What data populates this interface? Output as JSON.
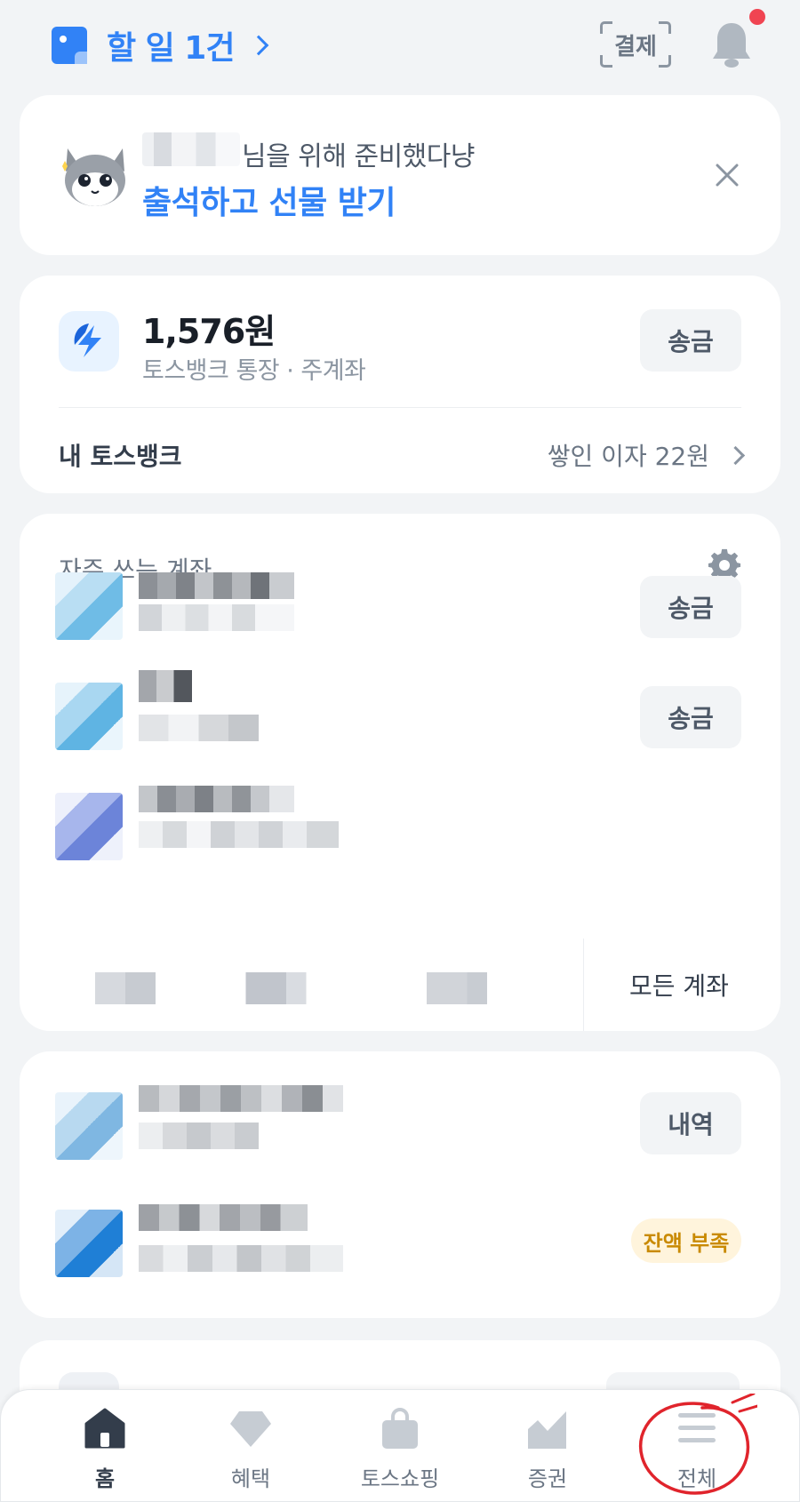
{
  "topbar": {
    "todo_label": "할 일 1건",
    "pay_label": "결제",
    "bell_icon": "bell-icon",
    "has_notification": true
  },
  "promo": {
    "line1": "님을 위해 준비했다냥",
    "line2": "출석하고 선물 받기",
    "mascot_icon": "cat-mascot-icon",
    "close_icon": "close-icon"
  },
  "bank": {
    "amount": "1,576원",
    "account_desc": "토스뱅크 통장 · 주계좌",
    "send_label": "송금",
    "my_bank_label": "내 토스뱅크",
    "interest_label": "쌓인 이자 22원"
  },
  "frequent": {
    "title": "자주 쓰는 계좌",
    "settings_icon": "gear-icon",
    "rows": [
      {
        "send_label": "송금"
      },
      {
        "send_label": "송금"
      },
      {
        "send_label": ""
      }
    ],
    "all_accounts_label": "모든 계좌"
  },
  "second_card": {
    "history_label": "내역",
    "insufficient_label": "잔액 부족"
  },
  "tabs": [
    {
      "label": "홈",
      "icon": "home-icon",
      "active": true
    },
    {
      "label": "혜택",
      "icon": "diamond-icon",
      "active": false
    },
    {
      "label": "토스쇼핑",
      "icon": "shopping-bag-icon",
      "active": false
    },
    {
      "label": "증권",
      "icon": "chart-icon",
      "active": false
    },
    {
      "label": "전체",
      "icon": "menu-icon",
      "active": false
    }
  ],
  "colors": {
    "accent": "#3182f6",
    "background": "#f2f4f6",
    "warning": "#c98a02",
    "annotation": "#e0242c"
  }
}
